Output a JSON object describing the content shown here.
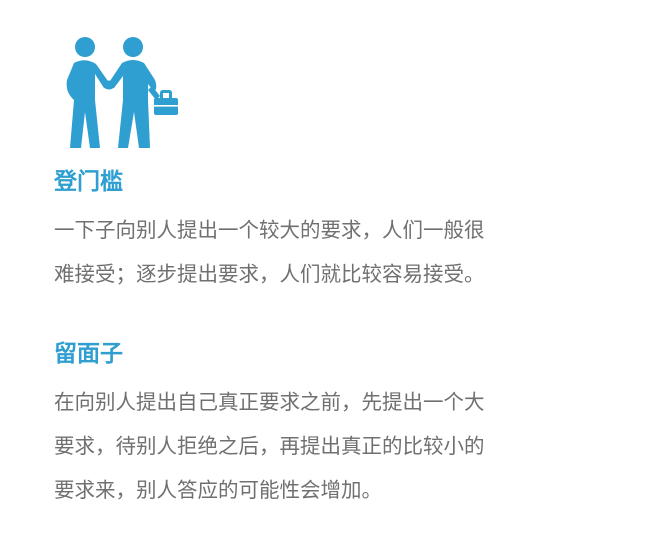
{
  "illustration": {
    "icon": "handshake-businessmen-icon",
    "color": "#2e9fd0"
  },
  "sections": [
    {
      "title": "登门槛",
      "lines": [
        "一下子向别人提出一个较大的要求，人们一般很",
        "难接受；逐步提出要求，人们就比较容易接受。"
      ]
    },
    {
      "title": "留面子",
      "lines": [
        "在向别人提出自己真正要求之前，先提出一个大",
        "要求，待别人拒绝之后，再提出真正的比较小的",
        "要求来，别人答应的可能性会增加。"
      ]
    }
  ],
  "colors": {
    "title": "#2e9fd0",
    "body": "#707070",
    "background": "#ffffff"
  }
}
